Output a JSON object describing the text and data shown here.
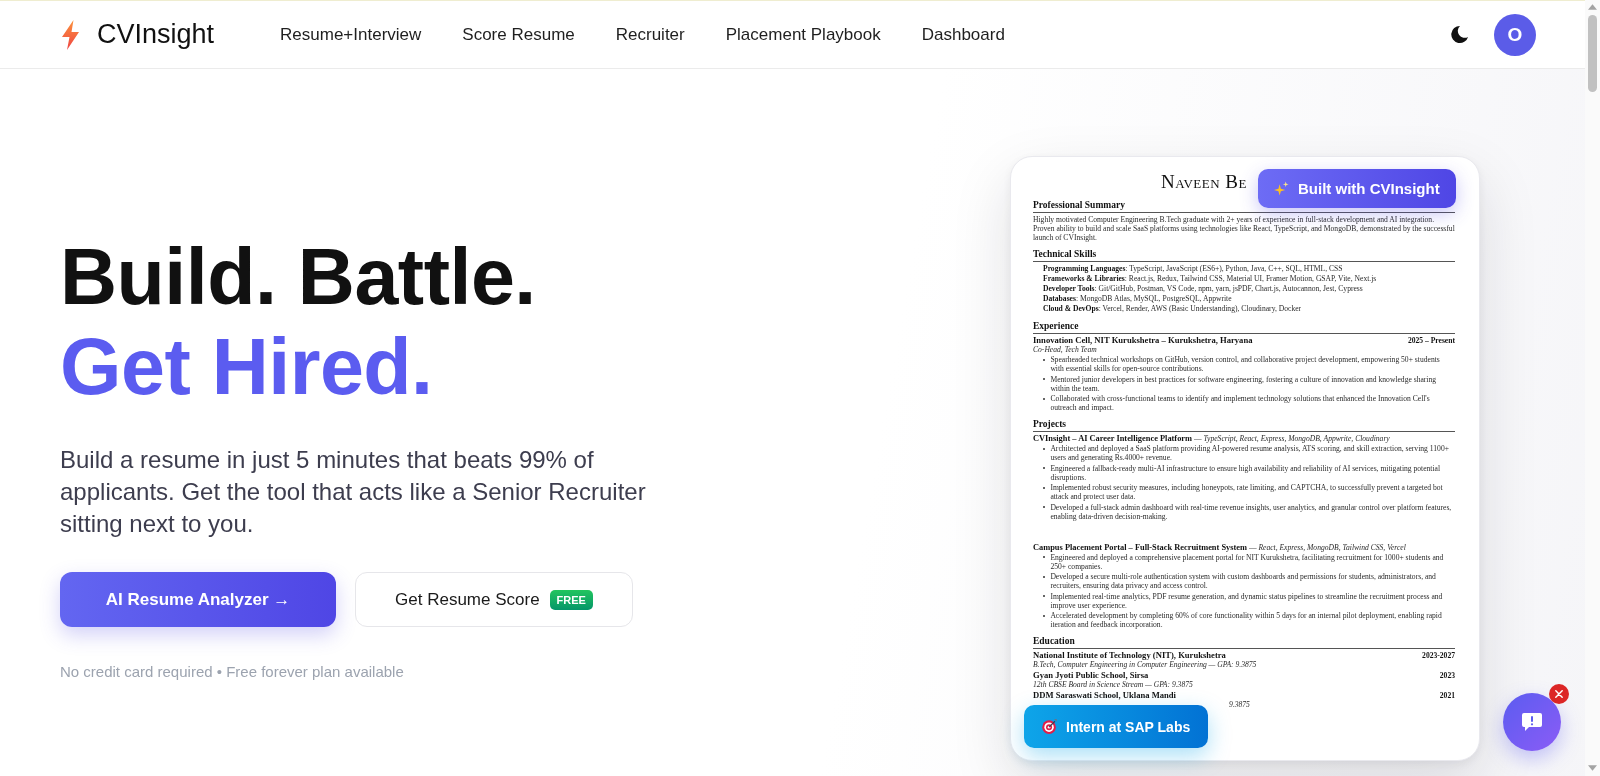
{
  "header": {
    "brand": "CVInsight",
    "nav_links": [
      "Resume+Interview",
      "Score Resume",
      "Recruiter",
      "Placement Playbook",
      "Dashboard"
    ],
    "avatar_initial": "O"
  },
  "hero": {
    "headline": [
      {
        "text": "Build. Battle.",
        "kind": "plain"
      },
      {
        "text": "Get Hired.",
        "kind": "accent"
      }
    ],
    "description": "Build a resume in just 5 minutes that beats 99% of applicants. Get the tool that acts like a Senior Recruiter sitting next to you.",
    "primary_button": "AI Resume Analyzer →",
    "secondary_button": {
      "label": "Get Resume Score",
      "badge": "FREE"
    },
    "footnote": "No credit card required • Free forever plan available"
  },
  "resume_preview": {
    "name": "Naveen Be",
    "sections": [
      {
        "kind": "paragraph",
        "heading": "Professional Summary",
        "text": "Highly motivated Computer Engineering B.Tech graduate with 2+ years of experience in full-stack development and AI integration. Proven ability to build and scale SaaS platforms using technologies like React, TypeScript, and MongoDB, demonstrated by the successful launch of CVInsight."
      },
      {
        "kind": "skills",
        "heading": "Technical Skills",
        "lines": [
          "**Programming Languages**: TypeScript, JavaScript (ES6+), Python, Java, C++, SQL, HTML, CSS",
          "**Frameworks & Libraries**: React.js, Redux, Tailwind CSS, Material UI, Framer Motion, GSAP, Vite, Next.js",
          "**Developer Tools**: Git/GitHub, Postman, VS Code, npm, yarn, jsPDF, Chart.js, Autocannon, Jest, Cypress",
          "**Databases**: MongoDB Atlas, MySQL, PostgreSQL, Appwrite",
          "**Cloud & DevOps**: Vercel, Render, AWS (Basic Understanding), Cloudinary, Docker"
        ]
      },
      {
        "kind": "experience",
        "heading": "Experience",
        "entries": [
          {
            "title": "Innovation Cell, NIT Kurukshetra – Kurukshetra, Haryana",
            "date": "2025 – Present",
            "role": "Co-Head, Tech Team",
            "bullets": [
              "Spearheaded technical workshops on GitHub, version control, and collaborative project development, empowering 50+ students with essential skills for open-source contributions.",
              "Mentored junior developers in best practices for software engineering, fostering a culture of innovation and knowledge sharing within the team.",
              "Collaborated with cross-functional teams to identify and implement technology solutions that enhanced the Innovation Cell's outreach and impact."
            ]
          }
        ]
      },
      {
        "kind": "projects",
        "heading": "Projects",
        "entries": [
          {
            "title": "**CVInsight – AI Career Intelligence Platform** — *TypeScript, React, Express, MongoDB, Appwrite, Cloudinary*",
            "bullets": [
              "Architected and deployed a SaaS platform providing AI-powered resume analysis, ATS scoring, and skill extraction, serving 1100+ users and generating Rs.4000+ revenue.",
              "Engineered a fallback-ready multi-AI infrastructure to ensure high availability and reliability of AI services, mitigating potential disruptions.",
              "Implemented robust security measures, including honeypots, rate limiting, and CAPTCHA, to successfully prevent a targeted bot attack and protect user data.",
              "Developed a full-stack admin dashboard with real-time revenue insights, user analytics, and granular control over platform features, enabling data-driven decision-making."
            ]
          },
          {
            "title": "**Campus Placement Portal – Full-Stack Recruitment System** — *React, Express, MongoDB, Tailwind CSS, Vercel*",
            "bullets": [
              "Engineered and deployed a comprehensive placement portal for NIT Kurukshetra, facilitating recruitment for 1000+ students and 250+ companies.",
              "Developed a secure multi-role authentication system with custom dashboards and permissions for students, administrators, and recruiters, ensuring data privacy and access control.",
              "Implemented real-time analytics, PDF resume generation, and dynamic status pipelines to streamline the recruitment process and improve user experience.",
              "Accelerated development by completing 60% of core functionality within 5 days for an internal pilot deployment, enabling rapid iteration and feedback incorporation."
            ]
          }
        ]
      },
      {
        "kind": "education",
        "heading": "Education",
        "entries": [
          {
            "school": "National Institute of Technology (NIT), Kurukshetra",
            "date": "2023-2027",
            "detail": "B.Tech, Computer Engineering in Computer Engineering — GPA: 9.3875"
          },
          {
            "school": "Gyan Jyoti Public School, Sirsa",
            "date": "2023",
            "detail": "12th CBSE Board in Science Stream — GPA: 9.3875"
          },
          {
            "school": "DDM Saraswati School, Uklana Mandi",
            "date": "2021",
            "detail": "9.3875"
          }
        ]
      }
    ],
    "badges": [
      {
        "kind": "built",
        "text": "Built with CVInsight"
      },
      {
        "kind": "achievement",
        "text": "Intern at SAP Labs"
      }
    ]
  }
}
